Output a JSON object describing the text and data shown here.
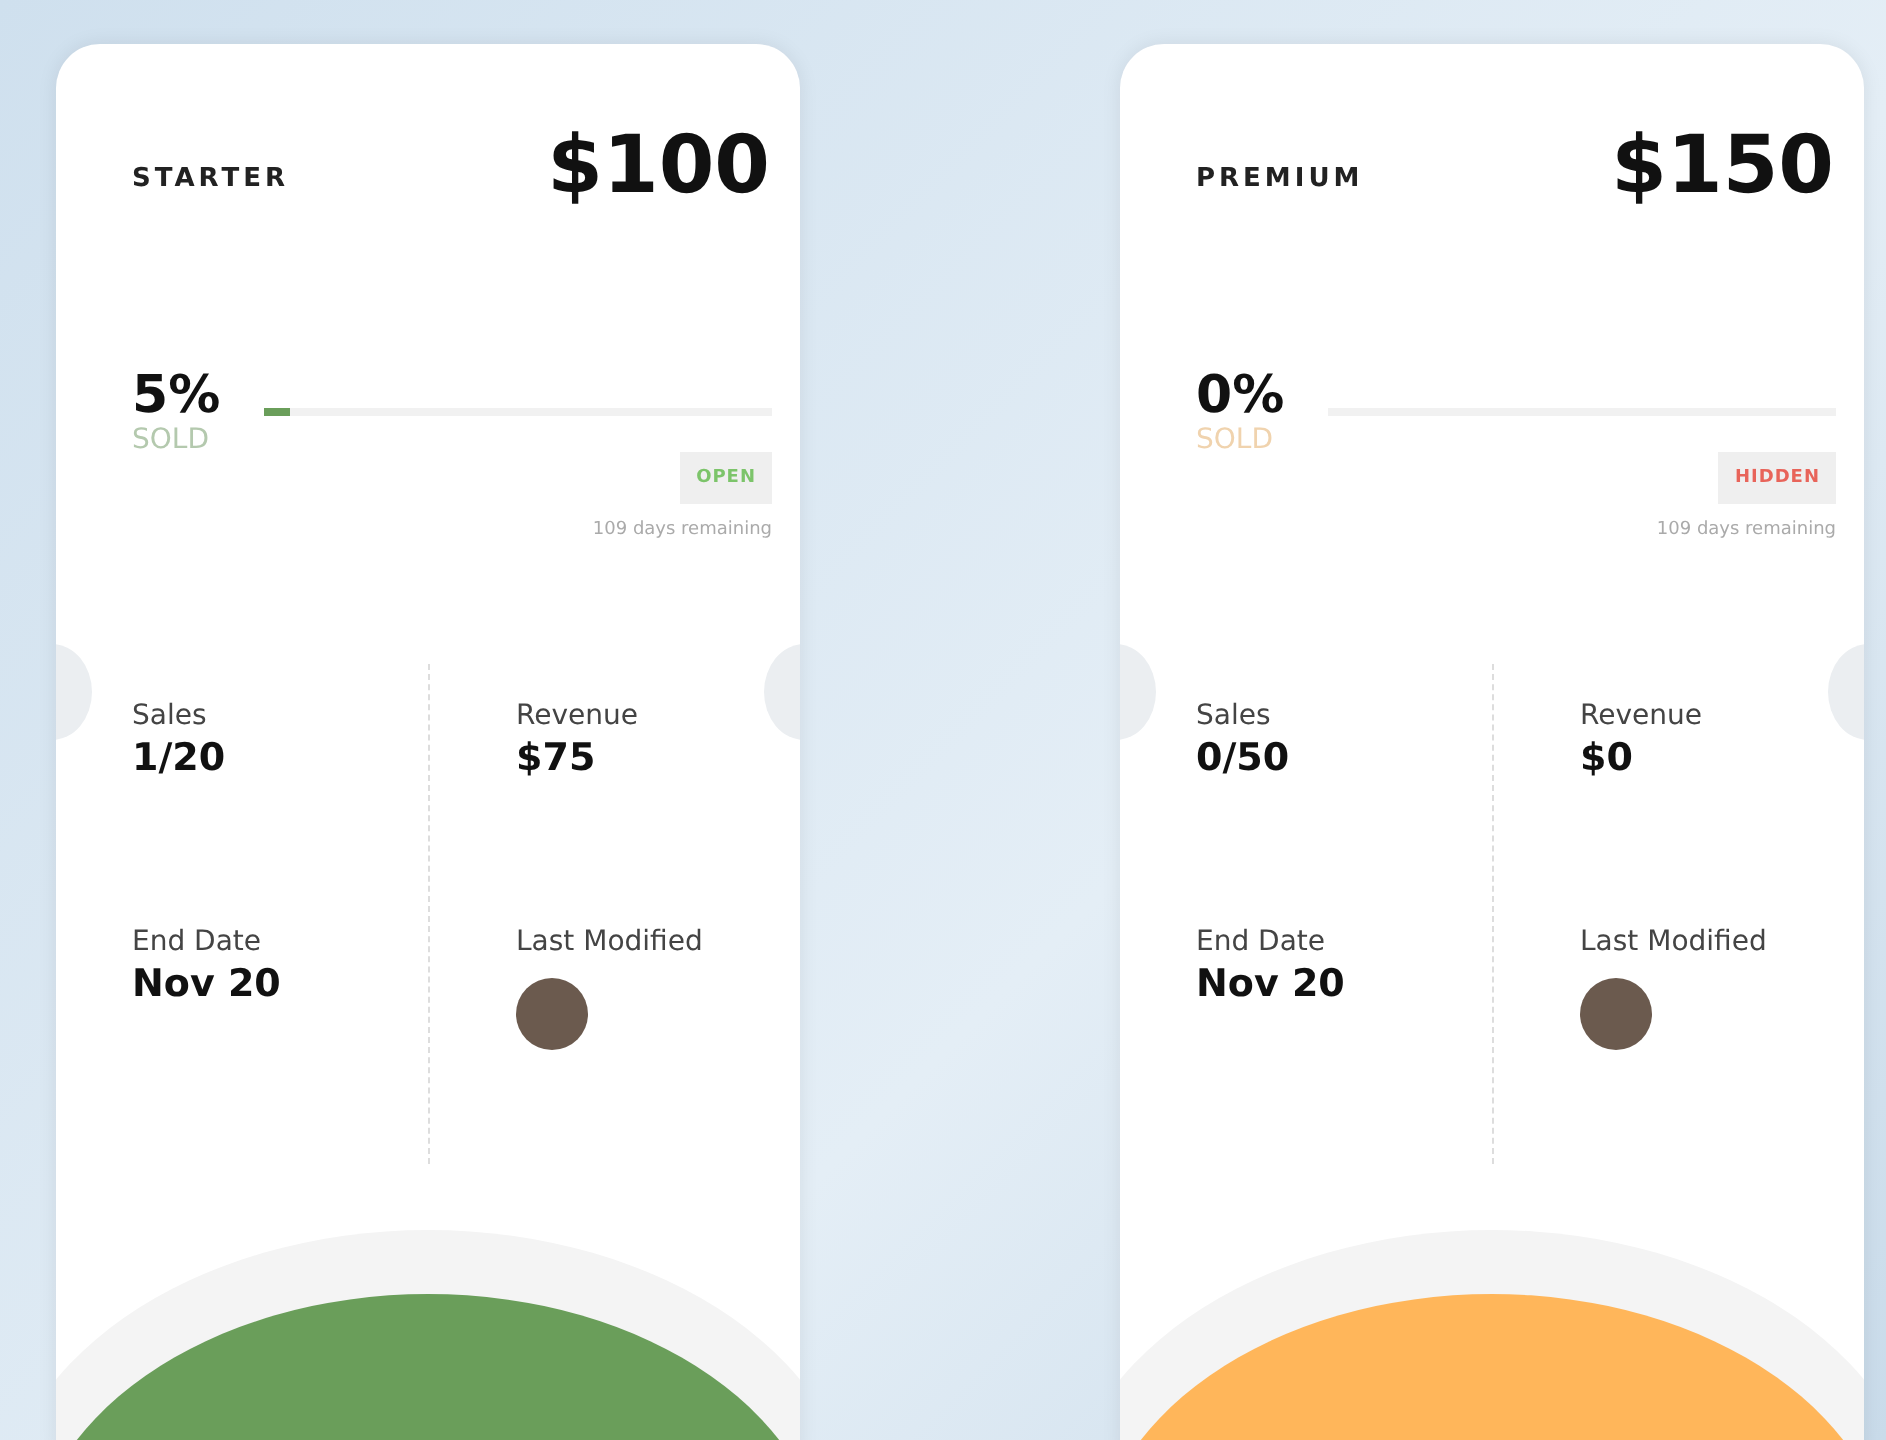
{
  "tickets": [
    {
      "tier": "STARTER",
      "price": "$100",
      "percent": "5%",
      "sold_label": "SOLD",
      "level": 0.05,
      "status": {
        "label": "OPEN",
        "kind": "open"
      },
      "remaining": "109 days remaining",
      "color": "#6a9e5a",
      "stats": [
        {
          "label": "Sales",
          "value": "1/20"
        },
        {
          "label": "Revenue",
          "value": "$75"
        },
        {
          "label": "End Date",
          "value": "Nov 20"
        },
        {
          "label": "Last Modified",
          "kind": "avatar"
        }
      ]
    },
    {
      "tier": "PREMIUM",
      "price": "$150",
      "percent": "0%",
      "sold_label": "SOLD",
      "level": 0,
      "status": {
        "label": "HIDDEN",
        "kind": "hidden"
      },
      "remaining": "109 days remaining",
      "color": "#ffb65a",
      "stats": [
        {
          "label": "Sales",
          "value": "0/50"
        },
        {
          "label": "Revenue",
          "value": "$0"
        },
        {
          "label": "End Date",
          "value": "Nov 20"
        },
        {
          "label": "Last Modified",
          "kind": "avatar"
        }
      ]
    }
  ]
}
